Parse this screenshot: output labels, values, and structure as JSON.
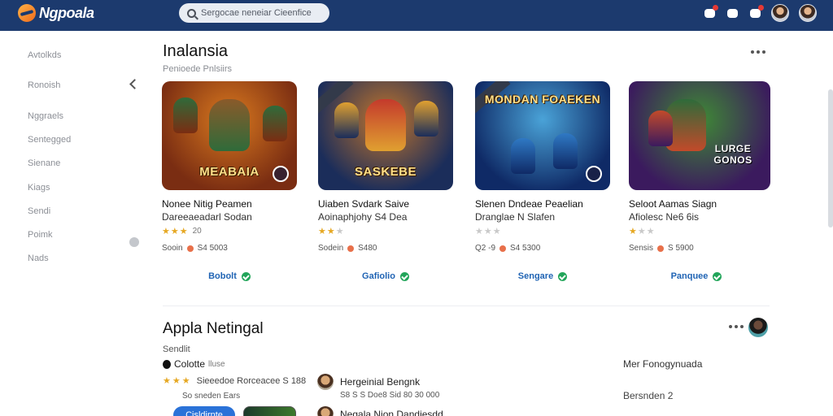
{
  "app": {
    "title": "Ngpoala"
  },
  "search": {
    "placeholder": "Sergocae neneiar Cieenfice"
  },
  "header": {
    "icons": [
      {
        "name": "notifications-icon",
        "badge": true
      },
      {
        "name": "chat-icon",
        "badge": false
      },
      {
        "name": "messages-icon",
        "badge": true
      }
    ]
  },
  "sidebar": {
    "items": [
      {
        "label": "Avtolkds"
      },
      {
        "label": "Ronoish"
      },
      {
        "label": "Nggraels"
      },
      {
        "label": "Sentegged"
      },
      {
        "label": "Sienane"
      },
      {
        "label": "Kiags"
      },
      {
        "label": "Sendi"
      },
      {
        "label": "Poimk"
      },
      {
        "label": "Nads"
      }
    ]
  },
  "section1": {
    "title": "Inalansia",
    "subtitle": "Penioede Pnlsiirs",
    "cards": [
      {
        "title": "Nonee Nitig Peamen",
        "developer": "Dareeaeadarl Sodan",
        "stars": 3,
        "rating": "20",
        "size": "Sooin",
        "downloads": "S4 5003",
        "action": "Bobolt",
        "game_logo": "MEABAIA",
        "colors": {
          "bg1": "#7a2d12",
          "bg2": "#d9791f",
          "hero": "#8a5a2a",
          "hero2": "#2f6b3a"
        }
      },
      {
        "title": "Uiaben Svdark Saive",
        "developer": "Aoinaphjohy S4 Dea",
        "stars": 2,
        "rating": "",
        "size": "Sodein",
        "downloads": "S480",
        "action": "Gafiolio",
        "game_logo": "SASKEBE",
        "ribbon": true,
        "colors": {
          "bg1": "#1b2d5a",
          "bg2": "#c2752b",
          "hero": "#c43a2c",
          "hero2": "#e0a030"
        }
      },
      {
        "title": "Slenen Dndeae Peaelian",
        "developer": "Dranglae N Slafen",
        "stars": 0,
        "rating": "",
        "size": "Q2 -9",
        "downloads": "S4 5300",
        "action": "Sengare",
        "game_logo": "MONDAN FOAEKEN",
        "ribbon": true,
        "colors": {
          "bg1": "#0f2a66",
          "bg2": "#4aa3d8",
          "hero": "#384c8f",
          "hero2": "#2f79c4"
        }
      },
      {
        "title": "Seloot Aamas Siagn",
        "developer": "Afiolesc Ne6 6is",
        "stars": 1,
        "rating": "",
        "size": "Sensis",
        "downloads": "S 5900",
        "action": "Panquee",
        "game_logo": "LURGE GONOS",
        "colors": {
          "bg1": "#3b1a5e",
          "bg2": "#3f8a35",
          "hero": "#2e6b3a",
          "hero2": "#c24a2a"
        }
      }
    ]
  },
  "section2": {
    "title": "Appla Netingal",
    "subtitle": "Sendlit",
    "category": "Colotte",
    "category_extra": "lluse",
    "stars": 3,
    "rating_text": "Sieeedoe Rorceacee S 188",
    "sizes_text": "So sneden Ears",
    "install_label": "Cisldirnte",
    "reviews": [
      {
        "name": "Hergeinial Bengnk",
        "meta": "S8 S S  Doe8  Sid 80 30 000"
      },
      {
        "name": "Negala Nion Dandiesdd"
      }
    ],
    "side_label": "Mer Fonogynuada",
    "side_value": "Bersnden 2"
  }
}
